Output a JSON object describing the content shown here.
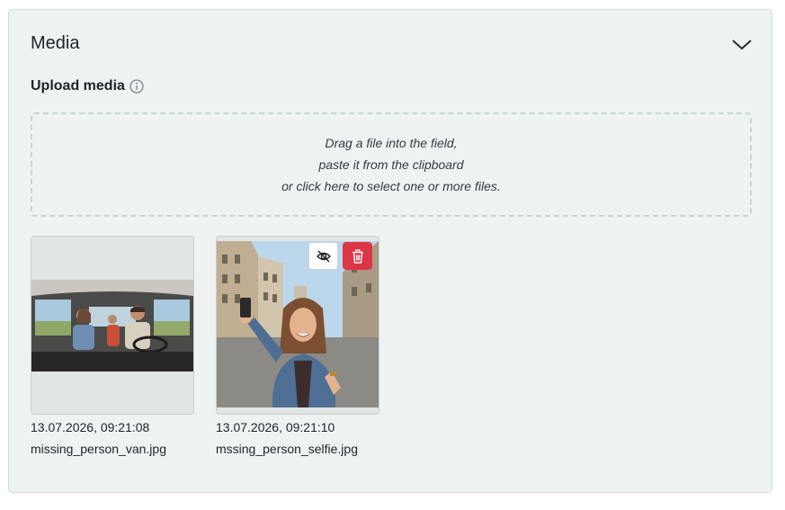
{
  "section": {
    "title": "Media"
  },
  "upload": {
    "label": "Upload media",
    "dropzone": {
      "line1": "Drag a file into the field,",
      "line2": "paste it from the clipboard",
      "line3": "or click here to select one or more files."
    }
  },
  "media": [
    {
      "date": "13.07.2026, 09:21:08",
      "filename": "missing_person_van.jpg"
    },
    {
      "date": "13.07.2026, 09:21:10",
      "filename": "mssing_person_selfie.jpg"
    }
  ],
  "icons": {
    "collapse": "chevron-down-icon",
    "info": "info-icon",
    "hide": "eye-slash-icon",
    "delete": "trash-icon"
  },
  "colors": {
    "delete": "#dc3545",
    "panel": "#eef3f2"
  }
}
